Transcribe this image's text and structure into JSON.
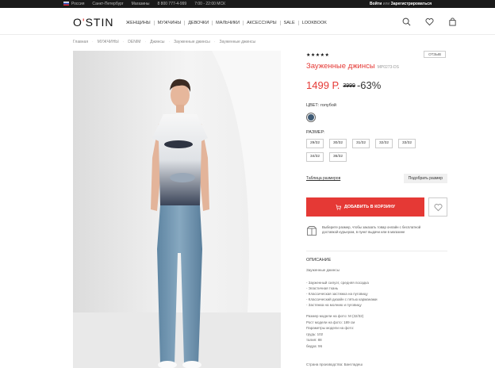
{
  "topbar": {
    "region": "Россия",
    "city": "Санкт-Петербург",
    "stores": "Магазины",
    "phone": "8 800 777-4-999",
    "hours": "7:00 - 22:00 МСК",
    "login": "Войти",
    "or": "или",
    "register": "Зарегистрироваться"
  },
  "brand": {
    "logo_main": "O",
    "logo_dot": "'",
    "logo_rest": "STIN"
  },
  "nav": [
    "ЖЕНЩИНЫ",
    "МУЖЧИНЫ",
    "ДЕВОЧКИ",
    "МАЛЬЧИКИ",
    "АКСЕССУАРЫ",
    "SALE",
    "LOOKBOOK"
  ],
  "breadcrumbs": [
    "Главная",
    "МУЖЧИНЫ",
    "DENIM",
    "Джинсы",
    "Зауженные джинсы",
    "Зауженные джинсы"
  ],
  "product": {
    "stars": "★★★★★",
    "badge": "ОТЗЫВ",
    "title": "Зауженные джинсы",
    "sku": "MP0273-DS",
    "price": "1499 Р.",
    "old_price": "3999",
    "discount": "-63%",
    "color_label": "ЦВЕТ: голубой",
    "swatch_color": "#3f5a74",
    "size_label": "РАЗМЕР:",
    "sizes": [
      "29/32",
      "30/32",
      "31/32",
      "32/32",
      "33/32",
      "34/32",
      "36/32"
    ],
    "size_table": "Таблица размеров",
    "pick_size": "Подобрать размер",
    "add_to_cart": "ДОБАВИТЬ В КОРЗИНУ",
    "info_text": "Выберите размер, чтобы заказать товар онлайн с бесплатной доставкой курьером, в пункт выдачи или в магазине",
    "description_head": "ОПИСАНИЕ",
    "description_name": "Зауженные джинсы",
    "features": [
      "- Зауженный силуэт, средняя посадка",
      "- Эластичная ткань",
      "- Классическая застежка на пуговицу",
      "- Классический дизайн с пятью карманами",
      "- Застежка на молнию и пуговицу"
    ],
    "params": [
      "Размер модели на фото: M (32/32)",
      "Рост модели на фото: 189 см",
      "Параметры модели на фото:",
      "грудь: 102",
      "талия: 88",
      "бедра: 96"
    ],
    "country": "Страна производства: Бангладеш"
  },
  "colors": {
    "accent": "#e53935",
    "topbar": "#1a1a1a"
  }
}
